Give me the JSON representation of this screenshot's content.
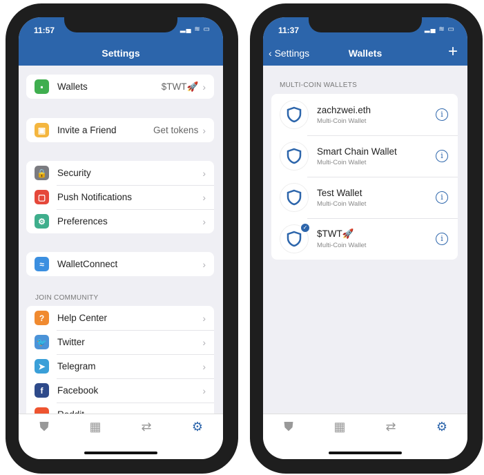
{
  "accent": "#2c65ab",
  "left": {
    "time": "11:57",
    "title": "Settings",
    "wallets": {
      "label": "Wallets",
      "value": "$TWT🚀",
      "icon": "wallet-icon",
      "color": "#3fae4f"
    },
    "invite": {
      "label": "Invite a Friend",
      "value": "Get tokens",
      "icon": "gift-icon",
      "color": "#f4b63f"
    },
    "group": [
      {
        "label": "Security",
        "icon": "lock-icon",
        "color": "#7b7b80",
        "glyph": "🔒"
      },
      {
        "label": "Push Notifications",
        "icon": "notification-icon",
        "color": "#e5483a",
        "glyph": "▢"
      },
      {
        "label": "Preferences",
        "icon": "gear-icon",
        "color": "#3fae8c",
        "glyph": "⚙"
      }
    ],
    "walletconnect": {
      "label": "WalletConnect",
      "icon": "walletconnect-icon",
      "color": "#3b8fe0",
      "glyph": "≈"
    },
    "community_title": "JOIN COMMUNITY",
    "community": [
      {
        "label": "Help Center",
        "icon": "help-icon",
        "color": "#f08a30",
        "glyph": "?"
      },
      {
        "label": "Twitter",
        "icon": "twitter-icon",
        "color": "#4b93d8",
        "glyph": "🐦"
      },
      {
        "label": "Telegram",
        "icon": "telegram-icon",
        "color": "#3a9fd8",
        "glyph": "➤"
      },
      {
        "label": "Facebook",
        "icon": "facebook-icon",
        "color": "#2e4a8a",
        "glyph": "f"
      },
      {
        "label": "Reddit",
        "icon": "reddit-icon",
        "color": "#ee5430",
        "glyph": "●"
      }
    ]
  },
  "right": {
    "time": "11:37",
    "back": "Settings",
    "title": "Wallets",
    "section": "MULTI-COIN WALLETS",
    "wallets": [
      {
        "name": "zachzwei.eth",
        "type": "Multi-Coin Wallet",
        "selected": false
      },
      {
        "name": "Smart Chain Wallet",
        "type": "Multi-Coin Wallet",
        "selected": false
      },
      {
        "name": "Test Wallet",
        "type": "Multi-Coin Wallet",
        "selected": false
      },
      {
        "name": "$TWT🚀",
        "type": "Multi-Coin Wallet",
        "selected": true
      }
    ]
  },
  "tabs": [
    {
      "icon": "shield-icon",
      "glyph": "⛊"
    },
    {
      "icon": "dapps-grid-icon",
      "glyph": "▦"
    },
    {
      "icon": "swap-icon",
      "glyph": "⇄"
    },
    {
      "icon": "settings-gear-icon",
      "glyph": "⚙",
      "active": true
    }
  ]
}
